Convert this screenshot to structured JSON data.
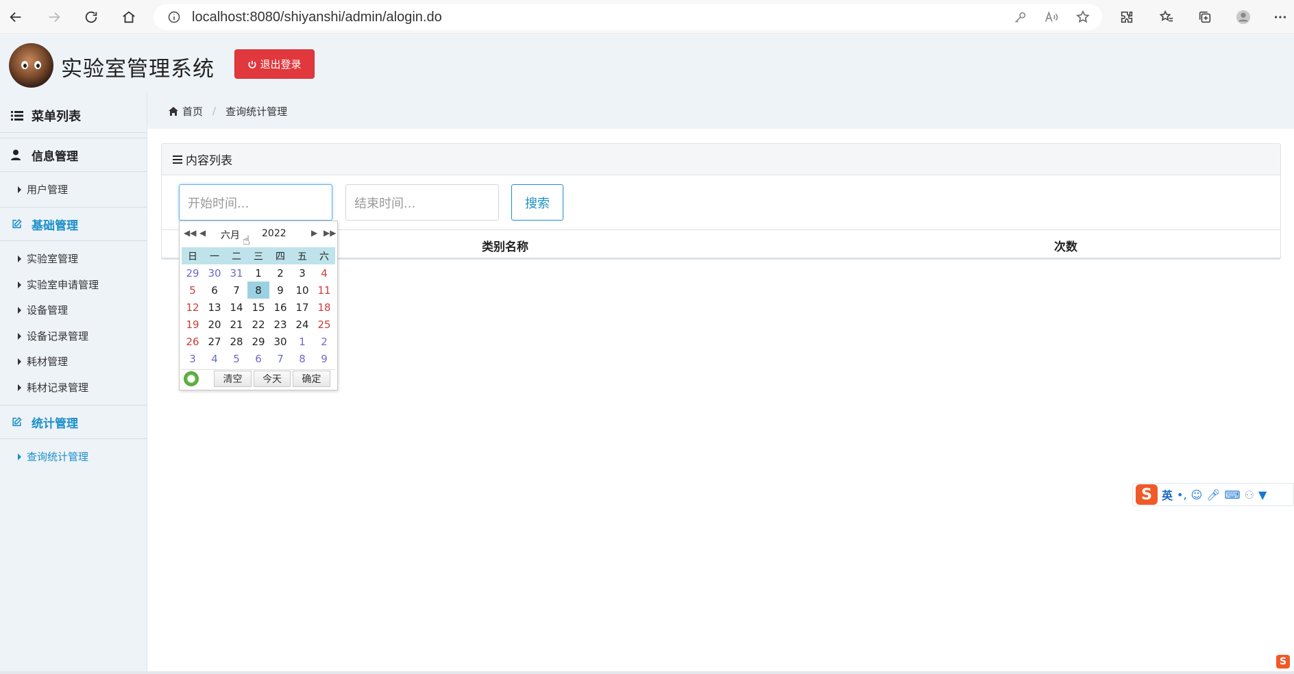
{
  "browser": {
    "url": "localhost:8080/shiyanshi/admin/alogin.do"
  },
  "header": {
    "title": "实验室管理系统",
    "logout_label": "退出登录"
  },
  "sidebar": {
    "menu_title": "菜单列表",
    "groups": [
      {
        "label": "信息管理",
        "items": [
          "用户管理"
        ]
      },
      {
        "label": "基础管理",
        "items": [
          "实验室管理",
          "实验室申请管理",
          "设备管理",
          "设备记录管理",
          "耗材管理",
          "耗材记录管理"
        ]
      },
      {
        "label": "统计管理",
        "items": [
          "查询统计管理"
        ]
      }
    ]
  },
  "breadcrumb": {
    "home": "首页",
    "current": "查询统计管理"
  },
  "panel": {
    "title": "内容列表",
    "start_placeholder": "开始时间...",
    "end_placeholder": "结束时间...",
    "search_label": "搜索",
    "columns": [
      "类别名称",
      "次数"
    ]
  },
  "calendar": {
    "month": "六月",
    "year": "2022",
    "weekdays": [
      "日",
      "一",
      "二",
      "三",
      "四",
      "五",
      "六"
    ],
    "weeks": [
      [
        "29",
        "30",
        "31",
        "1",
        "2",
        "3",
        "4"
      ],
      [
        "5",
        "6",
        "7",
        "8",
        "9",
        "10",
        "11"
      ],
      [
        "12",
        "13",
        "14",
        "15",
        "16",
        "17",
        "18"
      ],
      [
        "19",
        "20",
        "21",
        "22",
        "23",
        "24",
        "25"
      ],
      [
        "26",
        "27",
        "28",
        "29",
        "30",
        "1",
        "2"
      ],
      [
        "3",
        "4",
        "5",
        "6",
        "7",
        "8",
        "9"
      ]
    ],
    "selected_day": "8",
    "clear_label": "清空",
    "today_label": "今天",
    "ok_label": "确定"
  },
  "ime": {
    "logo": "S",
    "mode": "英"
  },
  "colors": {
    "accent": "#1a8fc9",
    "danger": "#e0383d",
    "sidebar_bg": "#eef3f8"
  }
}
